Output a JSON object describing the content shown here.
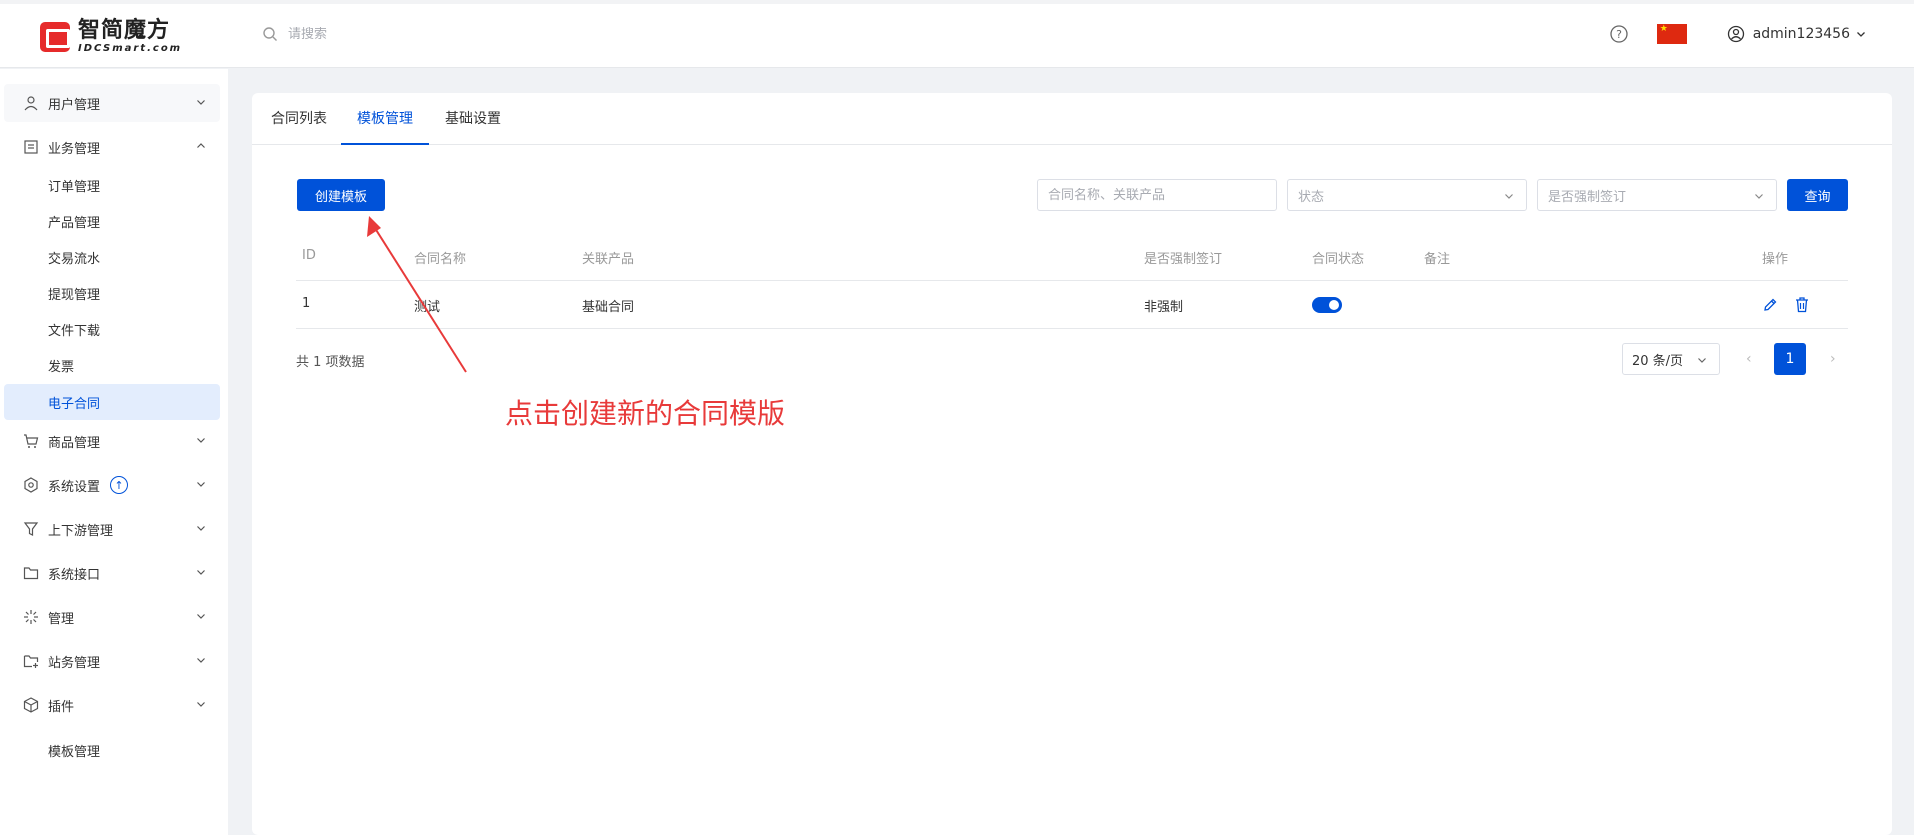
{
  "brand": {
    "name_cn": "智简魔方",
    "name_en": "IDCSmart.com"
  },
  "header": {
    "search_placeholder": "请搜索",
    "username": "admin123456"
  },
  "sidebar": {
    "user_mgmt": "用户管理",
    "business_mgmt": "业务管理",
    "sub_items": [
      "订单管理",
      "产品管理",
      "交易流水",
      "提现管理",
      "文件下载",
      "发票",
      "电子合同"
    ],
    "goods_mgmt": "商品管理",
    "system_settings": "系统设置",
    "upstream_mgmt": "上下游管理",
    "system_api": "系统接口",
    "management": "管理",
    "site_mgmt": "站务管理",
    "plugins": "插件",
    "template_mgmt": "模板管理"
  },
  "tabs": [
    "合同列表",
    "模板管理",
    "基础设置"
  ],
  "toolbar": {
    "create_label": "创建模板",
    "name_placeholder": "合同名称、关联产品",
    "status_placeholder": "状态",
    "forced_placeholder": "是否强制签订",
    "query_label": "查询"
  },
  "table": {
    "headers": [
      "ID",
      "合同名称",
      "关联产品",
      "是否强制签订",
      "合同状态",
      "备注",
      "操作"
    ],
    "rows": [
      {
        "id": "1",
        "name": "测试",
        "product": "基础合同",
        "forced": "非强制",
        "status_on": true,
        "remark": ""
      }
    ]
  },
  "pagination": {
    "total": "共 1 项数据",
    "page_size": "20 条/页",
    "current_page": "1"
  },
  "annotation": {
    "text": "点击创建新的合同模版",
    "color": "#e83a3a"
  },
  "colors": {
    "primary": "#0052d9",
    "active_bg": "#e3edfd"
  }
}
